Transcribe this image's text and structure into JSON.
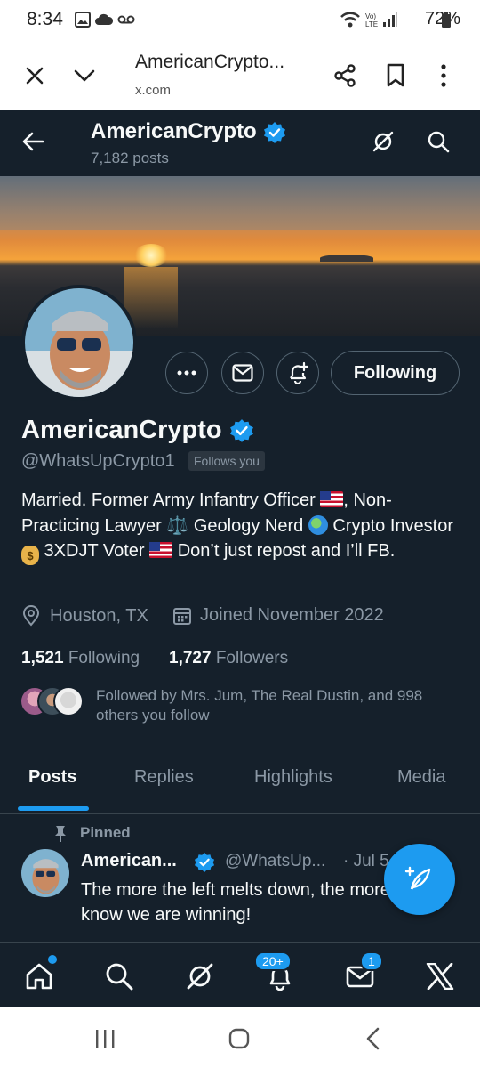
{
  "status_bar": {
    "time": "8:34",
    "battery": "72%"
  },
  "browser": {
    "title": "AmericanCrypto...",
    "url": "x.com"
  },
  "header": {
    "name": "AmericanCrypto",
    "post_count": "7,182 posts"
  },
  "profile": {
    "name": "AmericanCrypto",
    "handle": "@WhatsUpCrypto1",
    "follows_you": "Follows you",
    "following_button": "Following",
    "bio_parts": {
      "p1": "Married. Former Army Infantry Officer ",
      "p2": ", Non-Practicing Lawyer ",
      "scale": "⚖️",
      "p3": " Geology Nerd ",
      "p4": " Crypto Investor ",
      "bag": "$",
      "p5": " 3XDJT Voter ",
      "p6": " Don’t just repost and I’ll FB."
    },
    "location": "Houston, TX",
    "joined": "Joined November 2022",
    "following_count": "1,521",
    "following_label": "Following",
    "followers_count": "1,727",
    "followers_label": "Followers",
    "followed_by": "Followed by Mrs. Jum, The Real Dustin, and 998 others you follow"
  },
  "tabs": [
    {
      "label": "Posts",
      "active": true
    },
    {
      "label": "Replies",
      "active": false
    },
    {
      "label": "Highlights",
      "active": false
    },
    {
      "label": "Media",
      "active": false
    }
  ],
  "pinned_tweet": {
    "pinned_label": "Pinned",
    "name": "American...",
    "handle": "@WhatsUp...",
    "date": "· Jul 5",
    "text": "The more the left melts down, the more we know we are winning!"
  },
  "bottom_nav": {
    "notifications_badge": "20+",
    "messages_badge": "1"
  },
  "colors": {
    "accent": "#1d9bf0",
    "background": "#15202b",
    "muted": "#8b98a5"
  }
}
